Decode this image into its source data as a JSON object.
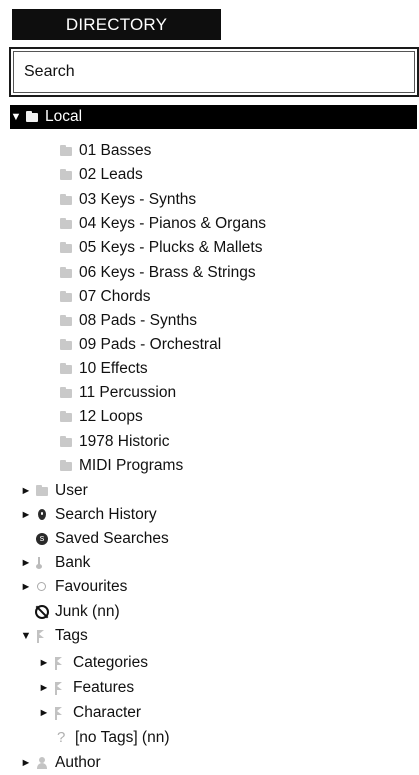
{
  "header": {
    "title": "DIRECTORY"
  },
  "search": {
    "placeholder": "Search"
  },
  "tree": {
    "local": {
      "label": "Local",
      "arrow": "▼"
    },
    "local_items": [
      "01 Basses",
      "02 Leads",
      "03 Keys - Synths",
      "04 Keys - Pianos & Organs",
      "05 Keys - Plucks & Mallets",
      "06 Keys - Brass & Strings",
      "07 Chords",
      "08 Pads - Synths",
      "09 Pads - Orchestral",
      "10 Effects",
      "11 Percussion",
      "12 Loops",
      "1978 Historic",
      "MIDI Programs"
    ],
    "user": {
      "label": "User",
      "arrow": "►"
    },
    "search_history": {
      "label": "Search History",
      "arrow": "►"
    },
    "saved_searches": {
      "label": "Saved Searches"
    },
    "bank": {
      "label": "Bank",
      "arrow": "►"
    },
    "favourites": {
      "label": "Favourites",
      "arrow": "►"
    },
    "junk": {
      "label": "Junk (nn)"
    },
    "tags": {
      "label": "Tags",
      "arrow": "▼"
    },
    "tag_items": {
      "categories": {
        "label": "Categories",
        "arrow": "►"
      },
      "features": {
        "label": "Features",
        "arrow": "►"
      },
      "character": {
        "label": "Character",
        "arrow": "►"
      },
      "no_tags": {
        "label": "[no Tags] (nn)"
      }
    },
    "author": {
      "label": "Author",
      "arrow": "►"
    }
  },
  "colors": {
    "selection": "#000000",
    "folder_icon": "#c9c9c9",
    "text": "#111111"
  }
}
